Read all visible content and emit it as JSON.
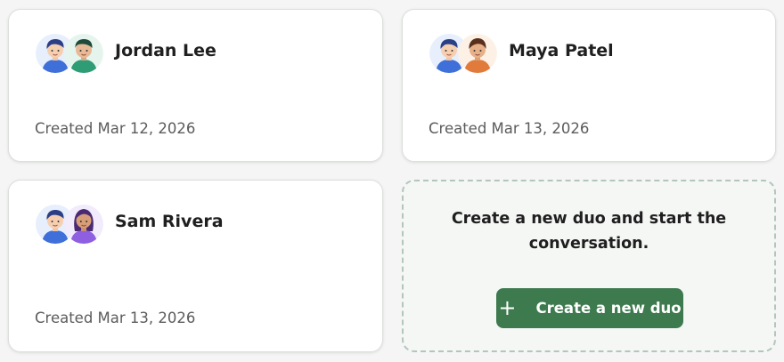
{
  "duos": [
    {
      "name": "Jordan Lee",
      "created": "Created Mar 12, 2026",
      "partner_avatar": "person-green-shirt-icon",
      "partner_color": "#2e9c74"
    },
    {
      "name": "Maya Patel",
      "created": "Created Mar 13, 2026",
      "partner_avatar": "person-orange-shirt-icon",
      "partner_color": "#e07b3c"
    },
    {
      "name": "Sam Rivera",
      "created": "Created Mar 13, 2026",
      "partner_avatar": "person-purple-shirt-icon",
      "partner_color": "#8e5fe0"
    }
  ],
  "self_avatar": {
    "icon": "person-blue-shirt-icon",
    "color": "#3f6fd8"
  },
  "create_card": {
    "prompt": "Create a new duo and start the conversation.",
    "button_label": "Create a new duo",
    "button_icon": "plus-icon",
    "accent": "#3d7a4e"
  }
}
